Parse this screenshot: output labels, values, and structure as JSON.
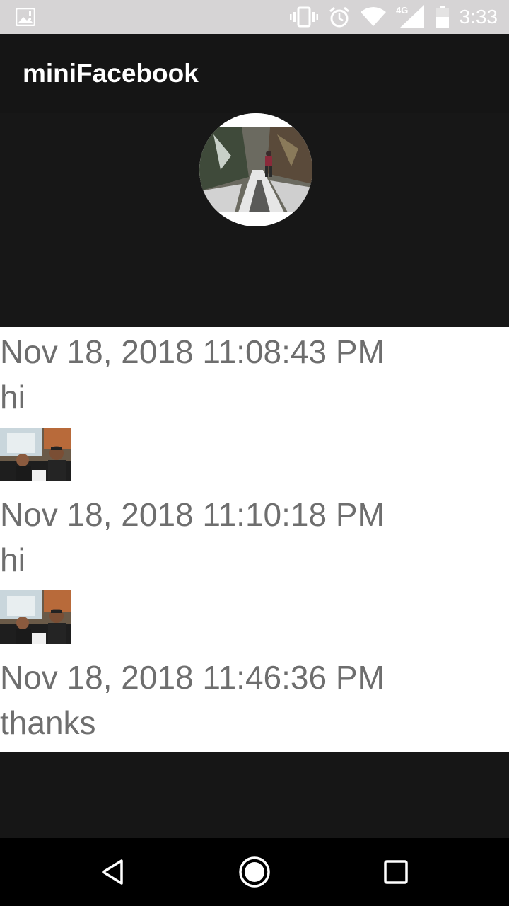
{
  "status_bar": {
    "time": "3:33",
    "network_label": "4G",
    "icons": [
      "image-notification-icon",
      "vibrate-icon",
      "alarm-icon",
      "wifi-icon",
      "cellular-signal-icon",
      "battery-icon"
    ]
  },
  "app_bar": {
    "title": "miniFacebook"
  },
  "profile": {
    "avatar": "profile-photo-snowy-trail"
  },
  "posts": [
    {
      "timestamp": "Nov 18, 2018 11:08:43 PM",
      "text": "hi",
      "thumbnail": "selfie-photo"
    },
    {
      "timestamp": "Nov 18, 2018 11:10:18 PM",
      "text": "hi",
      "thumbnail": "selfie-photo"
    },
    {
      "timestamp": "Nov 18, 2018 11:46:36 PM",
      "text": "thanks"
    }
  ],
  "nav_bar": {
    "icons": [
      "back-icon",
      "home-icon",
      "recents-icon"
    ]
  },
  "colors": {
    "status_bar_bg": "#d6d4d5",
    "app_bar_bg": "#151515",
    "feed_bg": "#ffffff",
    "feed_text": "#6e6e6e",
    "nav_bar_bg": "#000000"
  }
}
